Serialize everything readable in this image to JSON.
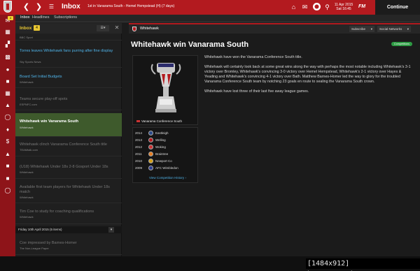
{
  "topbar": {
    "back_icon": "chevron-left-icon",
    "forward_icon": "chevron-right-icon",
    "title": "Inbox",
    "subtitle": "1st in Vanarama South - Hemel Hempstead (H) (7 days)",
    "home_icon": "home-icon",
    "mail_icon": "mail-icon",
    "club_icon": "club-crest-icon",
    "search_icon": "search-icon",
    "date": "11 Apr 2015",
    "time": "Sat 16:45",
    "logo": "FM",
    "continue_label": "Continue",
    "accent": "#b31a1f"
  },
  "rail": {
    "badge": "4",
    "icons": [
      "inbox-icon",
      "calendar-icon",
      "squad-icon",
      "tactics-icon",
      "staff-icon",
      "training-icon",
      "schedule-icon",
      "competition-icon",
      "scouting-icon",
      "transfers-icon",
      "finances-icon",
      "club-vision-icon",
      "career-icon",
      "save-icon",
      "history-icon"
    ]
  },
  "tabs": [
    "Inbox",
    "Headlines",
    "Subscriptions"
  ],
  "inbox": {
    "title": "Inbox",
    "count": "4",
    "menu_icon": "list-icon",
    "close_icon": "close-icon",
    "messages": [
      {
        "title": "",
        "from": "BBC Sport",
        "state": "unread"
      },
      {
        "title": "Torres leaves Whitehawk fans purring after fine display",
        "from": "Sky Sports News",
        "state": "unread"
      },
      {
        "title": "Board Set Initial Budgets",
        "from": "Whitehawk",
        "state": "unread"
      },
      {
        "title": "Teams secure play-off spots",
        "from": "ESPNFC.com",
        "state": "read"
      },
      {
        "title": "Whitehawk win Vanarama South",
        "from": "Whitehawk",
        "state": "selected"
      },
      {
        "title": "Whitehawk clinch Vanarama Conference South title",
        "from": "TEAMtalk.com",
        "state": "read"
      },
      {
        "title": "(U18) Whitehawk Under 18s 2-8 Gosport Under 18s",
        "from": "Whitehawk",
        "state": "read"
      },
      {
        "title": "Available first team players for Whitehawk Under 18s match",
        "from": "Whitehawk",
        "state": "read"
      },
      {
        "title": "Tim Coe to study for coaching qualifications",
        "from": "Whitehawk",
        "state": "read"
      },
      {
        "title": "Coe impressed by Barnes-Homer",
        "from": "The Non-League Paper",
        "state": "read"
      }
    ],
    "day_header": "Friday 10th April 2015 (5 items)"
  },
  "message": {
    "sender": "Whitehawk",
    "subscribe_label": "Subscribe",
    "social_label": "Social Networks",
    "headline": "Whitehawk win Vanarama South",
    "badge": "Competitions",
    "trophy_caption": "Vanarama Conference South",
    "history": [
      {
        "year": "2014",
        "team": "Eastleigh"
      },
      {
        "year": "2013",
        "team": "Welling"
      },
      {
        "year": "2012",
        "team": "Woking"
      },
      {
        "year": "2011",
        "team": "Braintree"
      },
      {
        "year": "2010",
        "team": "Newport Co"
      },
      {
        "year": "2009",
        "team": "AFC Wimbledon"
      }
    ],
    "history_link": "View Competition History",
    "paragraphs": [
      "Whitehawk have won the Vanarama Conference South title.",
      "Whitehawk will certainly look back at some great wins along the way with perhaps the most notable including Whitehawk's 3-1 victory over Bromley, Whitehawk's convincing 3-0 victory over Hemel Hempstead, Whitehawk's 2-1 victory over Hayes & Yeading and Whitehawk's convincing 4-1 victory over Bath. Matthew Barnes-Homer led the way to glory for the troubled Vanarama Conference South team by notching 23 goals en route to sealing the Vanarama South crown.",
      "Whitehawk have lost three of their last five away league games."
    ]
  },
  "watermark": "[1484x912] https://upic.me/"
}
